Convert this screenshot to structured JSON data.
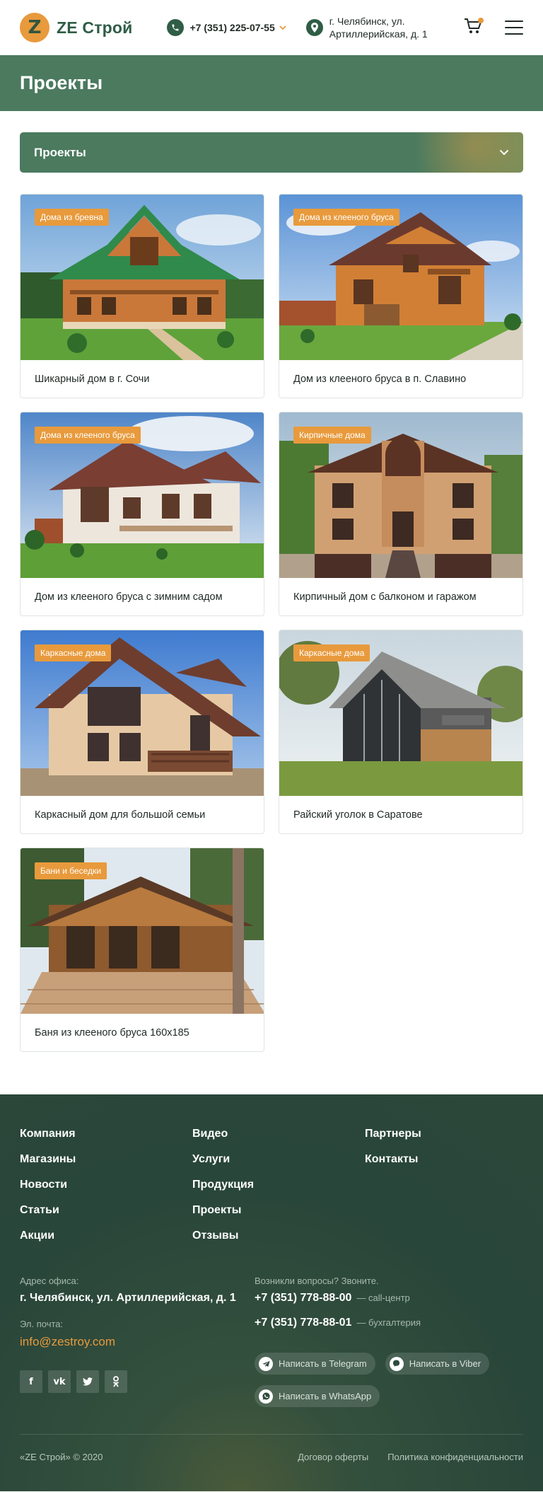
{
  "header": {
    "logo_letter": "Z",
    "logo_text": "ZE Строй",
    "phone": "+7 (351) 225-07-55",
    "address": "г. Челябинск, ул. Артиллерийская, д. 1"
  },
  "page": {
    "title": "Проекты"
  },
  "filter": {
    "selected": "Проекты"
  },
  "projects": [
    {
      "tag": "Дома из бревна",
      "title": "Шикарный дом в г. Сочи"
    },
    {
      "tag": "Дома из клееного бруса",
      "title": "Дом из клееного бруса в п. Славино"
    },
    {
      "tag": "Дома из клееного бруса",
      "title": "Дом из клееного бруса с зимним садом"
    },
    {
      "tag": "Кирпичные дома",
      "title": "Кирпичный дом с балконом и гаражом"
    },
    {
      "tag": "Каркасные дома",
      "title": "Каркасный дом для большой семьи"
    },
    {
      "tag": "Каркасные дома",
      "title": "Райский уголок в Саратове"
    },
    {
      "tag": "Бани и беседки",
      "title": "Баня из клееного бруса 160х185"
    }
  ],
  "footer": {
    "nav": [
      "Компания",
      "Видео",
      "Партнеры",
      "Магазины",
      "Услуги",
      "Контакты",
      "Новости",
      "Продукция",
      "",
      "Статьи",
      "Проекты",
      "",
      "Акции",
      "Отзывы",
      ""
    ],
    "office_label": "Адрес офиса:",
    "office_address": "г. Челябинск, ул. Артиллерийская, д. 1",
    "email_label": "Эл. почта:",
    "email": "info@zestroy.com",
    "socials": [
      "f",
      "vk",
      "tw",
      "ok"
    ],
    "question_label": "Возникли вопросы? Звоните.",
    "phones": [
      {
        "number": "+7 (351) 778-88-00",
        "note": "— call-центр"
      },
      {
        "number": "+7 (351) 778-88-01",
        "note": "— бухгалтерия"
      }
    ],
    "messengers": [
      "Написать в Telegram",
      "Написать в Viber",
      "Написать в WhatsApp"
    ],
    "copyright": "«ZE Строй» © 2020",
    "links": [
      "Договор оферты",
      "Политика конфиденциальности"
    ]
  },
  "colors": {
    "brand_green": "#4b7a5f",
    "brand_orange": "#e89a3c",
    "footer_bg": "#29463a"
  }
}
